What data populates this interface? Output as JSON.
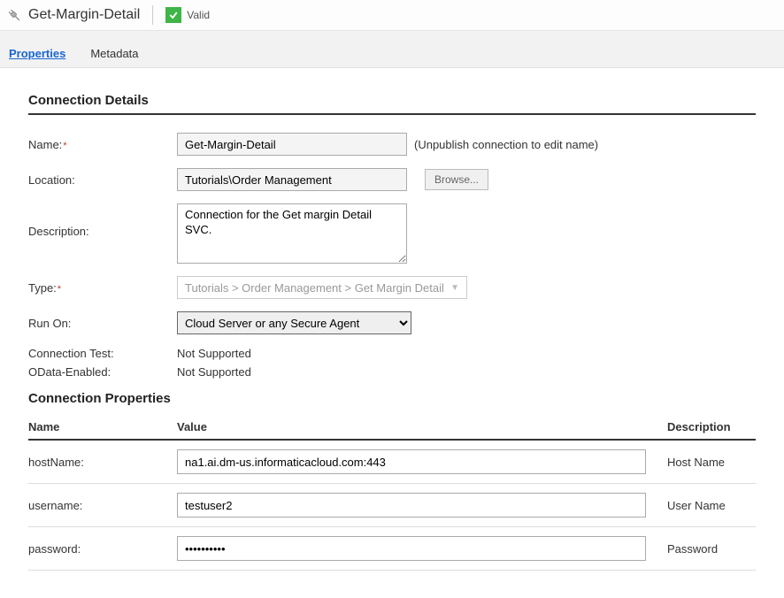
{
  "header": {
    "title": "Get-Margin-Detail",
    "statusLabel": "Valid"
  },
  "tabs": {
    "properties": "Properties",
    "metadata": "Metadata"
  },
  "section1Title": "Connection Details",
  "labels": {
    "name": "Name:",
    "location": "Location:",
    "description": "Description:",
    "type": "Type:",
    "runOn": "Run On:",
    "connTest": "Connection Test:",
    "odata": "OData-Enabled:"
  },
  "values": {
    "name": "Get-Margin-Detail",
    "nameHint": "(Unpublish connection to edit name)",
    "location": "Tutorials\\Order Management",
    "browseBtn": "Browse...",
    "description": "Connection for the Get margin Detail SVC.",
    "type": "Tutorials > Order Management > Get Margin Detail",
    "runOn": "Cloud Server or any Secure Agent",
    "connTest": "Not Supported",
    "odata": "Not Supported"
  },
  "section2Title": "Connection Properties",
  "propCols": {
    "name": "Name",
    "value": "Value",
    "description": "Description"
  },
  "props": [
    {
      "name": "hostName:",
      "value": "na1.ai.dm-us.informaticacloud.com:443",
      "desc": "Host Name"
    },
    {
      "name": "username:",
      "value": "testuser2",
      "desc": "User Name"
    },
    {
      "name": "password:",
      "value": "••••••••••",
      "desc": "Password"
    }
  ]
}
